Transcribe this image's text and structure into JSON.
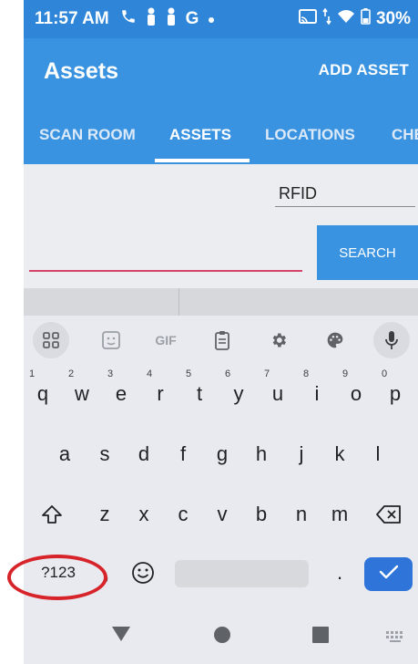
{
  "status_bar": {
    "time": "11:57 AM",
    "carrier_letter": "G",
    "battery": "30%",
    "icons": [
      "phone-icon",
      "person-icon",
      "person-icon",
      "g-icon",
      "dot-icon",
      "cast-icon",
      "data-arrows-icon",
      "wifi-icon",
      "battery-icon"
    ]
  },
  "app_bar": {
    "title": "Assets",
    "action": "ADD ASSET"
  },
  "tabs": [
    {
      "label": "SCAN ROOM",
      "active": false
    },
    {
      "label": "ASSETS",
      "active": true
    },
    {
      "label": "LOCATIONS",
      "active": false
    },
    {
      "label": "CHE",
      "active": false
    }
  ],
  "form": {
    "type_field_value": "RFID",
    "search_input_value": "",
    "search_button_label": "SEARCH"
  },
  "keyboard": {
    "toolbar": [
      {
        "name": "grid-icon"
      },
      {
        "name": "sticker-icon"
      },
      {
        "name": "gif-icon",
        "label": "GIF"
      },
      {
        "name": "clipboard-icon"
      },
      {
        "name": "gear-icon"
      },
      {
        "name": "palette-icon"
      },
      {
        "name": "microphone-icon"
      }
    ],
    "row1": [
      {
        "key": "q",
        "hint": "1"
      },
      {
        "key": "w",
        "hint": "2"
      },
      {
        "key": "e",
        "hint": "3"
      },
      {
        "key": "r",
        "hint": "4"
      },
      {
        "key": "t",
        "hint": "5"
      },
      {
        "key": "y",
        "hint": "6"
      },
      {
        "key": "u",
        "hint": "7"
      },
      {
        "key": "i",
        "hint": "8"
      },
      {
        "key": "o",
        "hint": "9"
      },
      {
        "key": "p",
        "hint": "0"
      }
    ],
    "row2": [
      "a",
      "s",
      "d",
      "f",
      "g",
      "h",
      "j",
      "k",
      "l"
    ],
    "row3": [
      "z",
      "x",
      "c",
      "v",
      "b",
      "n",
      "m"
    ],
    "symbols_key": "?123",
    "comma_key": ",",
    "period_key": ".",
    "shift_icon": "shift-icon",
    "backspace_icon": "backspace-icon",
    "emoji_icon": "emoji-icon",
    "enter_icon": "checkmark-icon"
  },
  "nav_bar": [
    "back-icon",
    "home-icon",
    "recents-icon",
    "keyboard-switch-icon"
  ],
  "colors": {
    "primary": "#3a93e0",
    "status_bar": "#2f86d8",
    "accent_underline": "#d4436a",
    "enter_key": "#2e74d9",
    "annotation": "#d7242a"
  }
}
